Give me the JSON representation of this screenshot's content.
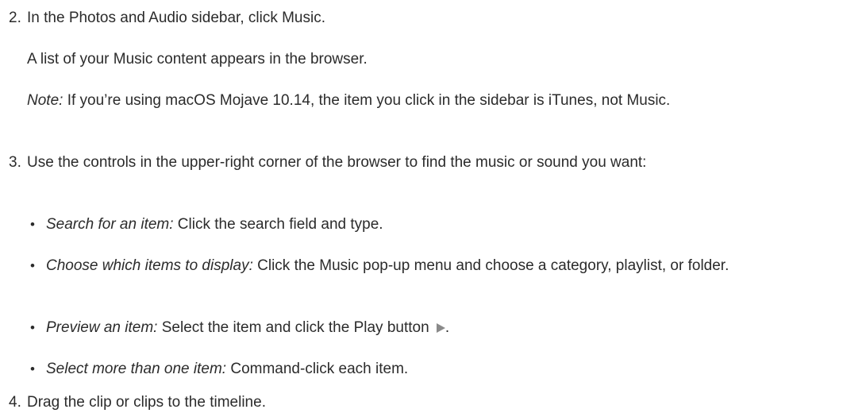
{
  "step2": {
    "number": "2.",
    "text": "In the Photos and Audio sidebar, click Music.",
    "result": "A list of your Music content appears in the browser.",
    "note_label": "Note:",
    "note_text": " If you’re using macOS Mojave 10.14, the item you click in the sidebar is iTunes, not Music."
  },
  "step3": {
    "number": "3.",
    "text": "Use the controls in the upper-right corner of the browser to find the music or sound you want:",
    "bullets": [
      {
        "label": "Search for an item:",
        "text": "  Click the search field and type."
      },
      {
        "label": "Choose which items to display:",
        "text": " Click the Music pop-up menu and choose a category, playlist, or folder."
      },
      {
        "label": "Preview an item:",
        "text": " Select the item and click the Play button ",
        "icon": "play-icon",
        "suffix": "."
      },
      {
        "label": "Select more than one item:",
        "text": " Command-click each item."
      }
    ]
  },
  "step4": {
    "number": "4.",
    "text": "Drag the clip or clips to the timeline."
  },
  "bullet_glyph": "•"
}
